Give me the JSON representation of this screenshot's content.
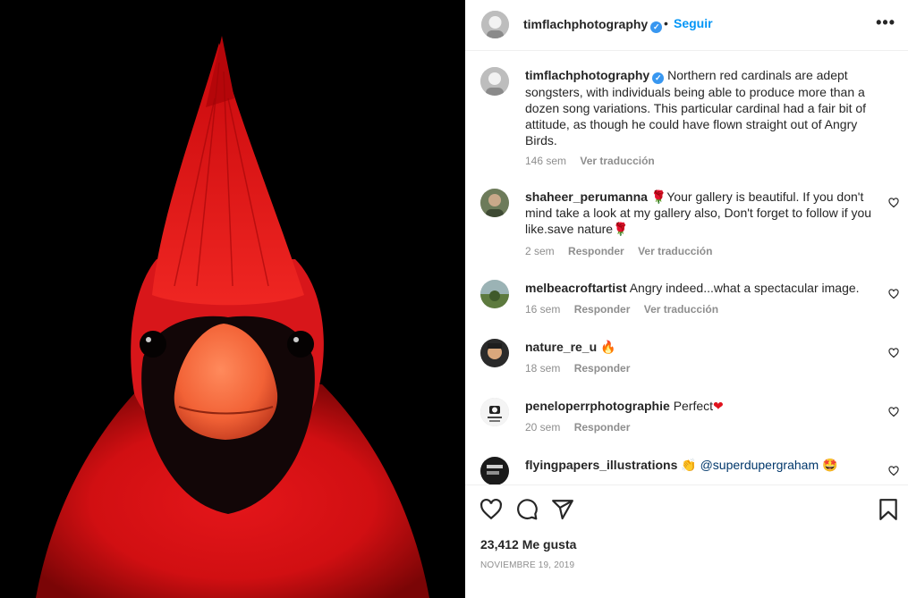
{
  "post": {
    "author": "timflachphotography",
    "follow_label": "Seguir",
    "separator": "•",
    "more_label": "•••"
  },
  "caption": {
    "username": "timflachphotography",
    "text": "Northern red cardinals are adept songsters, with individuals being able to produce more than a dozen song variations. This particular cardinal had a fair bit of attitude, as though he could have flown straight out of Angry Birds.",
    "time": "146 sem",
    "translate_label": "Ver traducción"
  },
  "comments": [
    {
      "username": "shaheer_perumanna",
      "text_before": "Your gallery is beautiful. If you don't mind take a look at my gallery also, Don't forget to follow if you like.save nature",
      "time": "2 sem",
      "reply_label": "Responder",
      "translate_label": "Ver traducción"
    },
    {
      "username": "melbeacroftartist",
      "text": "Angry indeed...what a spectacular image.",
      "time": "16 sem",
      "reply_label": "Responder",
      "translate_label": "Ver traducción"
    },
    {
      "username": "nature_re_u",
      "text": "",
      "time": "18 sem",
      "reply_label": "Responder"
    },
    {
      "username": "peneloperrphotographie",
      "text": "Perfect",
      "time": "20 sem",
      "reply_label": "Responder"
    },
    {
      "username": "flyingpapers_illustrations",
      "mention": "@superdupergraham",
      "time": "",
      "reply_label": ""
    }
  ],
  "stats": {
    "likes": "23,412 Me gusta",
    "date": "NOVIEMBRE 19, 2019"
  },
  "colors": {
    "accent": "#0095f6",
    "verified": "#3897f0",
    "muted": "#8e8e8e",
    "text": "#262626"
  },
  "icons": [
    "heart-icon",
    "comment-icon",
    "share-icon",
    "bookmark-icon",
    "more-icon",
    "verified-badge-icon"
  ]
}
